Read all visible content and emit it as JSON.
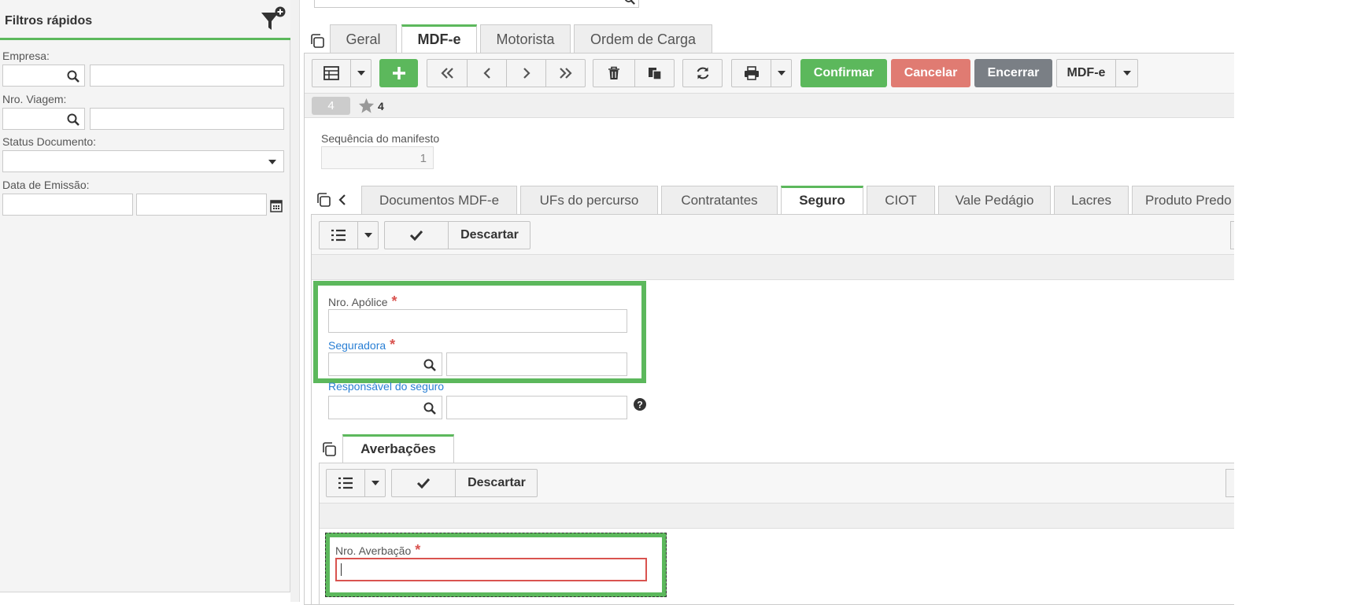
{
  "filters": {
    "title": "Filtros rápidos",
    "empresa_label": "Empresa:",
    "viagem_label": "Nro. Viagem:",
    "status_label": "Status Documento:",
    "emissao_label": "Data de Emissão:"
  },
  "main_tabs": [
    {
      "label": "Geral",
      "active": false
    },
    {
      "label": "MDF-e",
      "active": true
    },
    {
      "label": "Motorista",
      "active": false
    },
    {
      "label": "Ordem de Carga",
      "active": false
    }
  ],
  "toolbar": {
    "confirm": "Confirmar",
    "cancel": "Cancelar",
    "close": "Encerrar",
    "mdfe": "MDF-e",
    "record_badge": "4",
    "star_count": "4"
  },
  "form": {
    "seq_label": "Sequência do manifesto",
    "seq_value": "1"
  },
  "sub_tabs": [
    {
      "label": "Documentos MDF-e",
      "active": false
    },
    {
      "label": "UFs do percurso",
      "active": false
    },
    {
      "label": "Contratantes",
      "active": false
    },
    {
      "label": "Seguro",
      "active": true
    },
    {
      "label": "CIOT",
      "active": false
    },
    {
      "label": "Vale Pedágio",
      "active": false
    },
    {
      "label": "Lacres",
      "active": false
    },
    {
      "label": "Produto Predo",
      "active": false
    }
  ],
  "seguro": {
    "discard": "Descartar",
    "apolice_label": "Nro. Apólice",
    "seguradora_label": "Seguradora",
    "responsavel_label": "Responsável do seguro",
    "averbacoes_tab": "Averbações",
    "discard2": "Descartar",
    "averbacao_label": "Nro. Averbação"
  },
  "colors": {
    "green": "#5cb85c",
    "red": "#e07b72",
    "gray": "#7a7f85",
    "link": "#2a7fd4"
  }
}
